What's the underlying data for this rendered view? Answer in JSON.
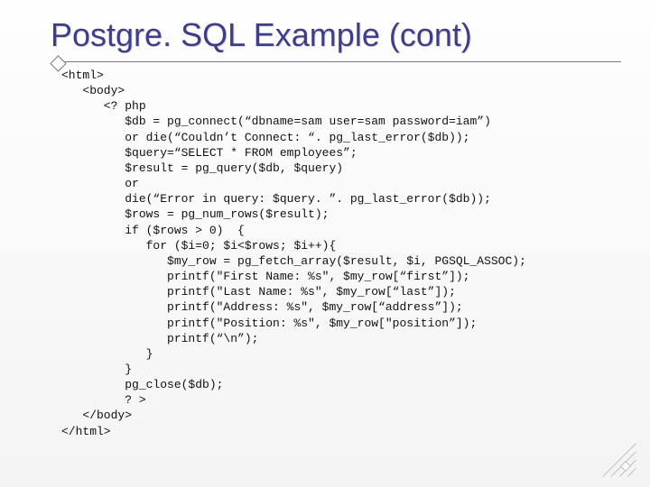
{
  "title": "Postgre. SQL Example (cont)",
  "code": "<html>\n   <body>\n      <? php\n         $db = pg_connect(“dbname=sam user=sam password=iam”)\n         or die(“Couldn’t Connect: “. pg_last_error($db));\n         $query=“SELECT * FROM employees”;\n         $result = pg_query($db, $query)\n         or\n         die(“Error in query: $query. ”. pg_last_error($db));\n         $rows = pg_num_rows($result);\n         if ($rows > 0)  {\n            for ($i=0; $i<$rows; $i++){\n               $my_row = pg_fetch_array($result, $i, PGSQL_ASSOC);\n               printf(\"First Name: %s\", $my_row[“first”]);\n               printf(\"Last Name: %s\", $my_row[“last”]);\n               printf(\"Address: %s\", $my_row[“address”]);\n               printf(\"Position: %s\", $my_row[\"position”]);\n               printf(“\\n”);\n            }\n         }\n         pg_close($db);\n         ? >\n   </body>\n</html>"
}
